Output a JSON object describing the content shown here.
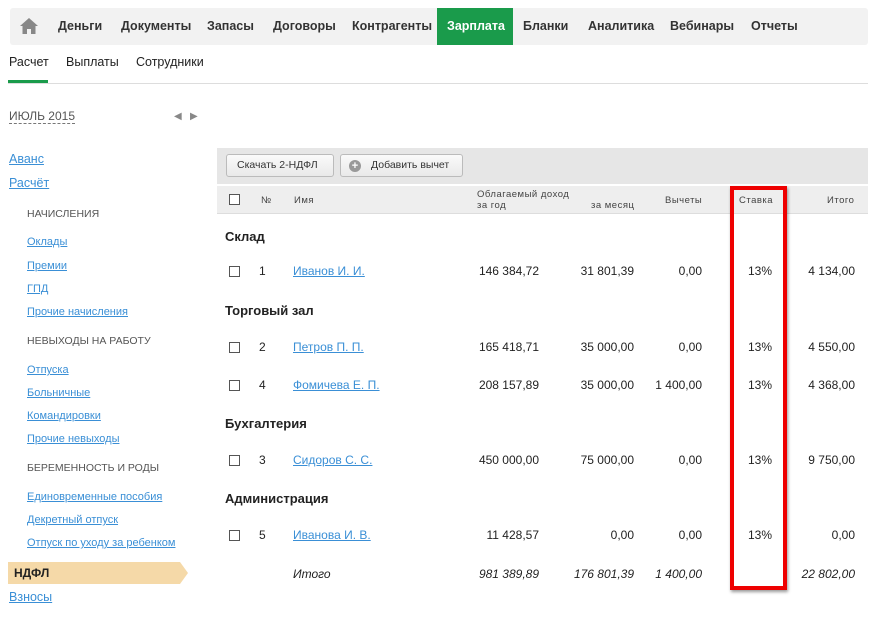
{
  "topnav": {
    "items": [
      "Деньги",
      "Документы",
      "Запасы",
      "Договоры",
      "Контрагенты",
      "Зарплата",
      "Бланки",
      "Аналитика",
      "Вебинары",
      "Отчеты"
    ],
    "active": "Зарплата"
  },
  "subnav": {
    "items": [
      "Расчет",
      "Выплаты",
      "Сотрудники"
    ],
    "active": "Расчет"
  },
  "sidebar": {
    "period": "ИЮЛЬ 2015",
    "links_top": [
      "Аванс",
      "Расчёт"
    ],
    "sections": [
      {
        "title": "НАЧИСЛЕНИЯ",
        "items": [
          "Оклады",
          "Премии",
          "ГПД",
          "Прочие начисления"
        ]
      },
      {
        "title": "НЕВЫХОДЫ НА РАБОТУ",
        "items": [
          "Отпуска",
          "Больничные",
          "Командировки",
          "Прочие невыходы"
        ]
      },
      {
        "title": "БЕРЕМЕННОСТЬ И РОДЫ",
        "items": [
          "Единовременные пособия",
          "Декретный отпуск",
          "Отпуск по уходу за ребенком"
        ]
      }
    ],
    "active": "НДФЛ",
    "bottom": "Взносы"
  },
  "toolbar": {
    "download": "Скачать 2-НДФЛ",
    "add_deduction": "Добавить вычет"
  },
  "table": {
    "headers": {
      "num": "№",
      "name": "Имя",
      "income_year_1": "Облагаемый доход",
      "income_year_2": "за год",
      "income_month": "за месяц",
      "deductions": "Вычеты",
      "rate": "Ставка",
      "total": "Итого"
    },
    "groups": [
      {
        "name": "Склад",
        "rows": [
          {
            "num": "1",
            "name": "Иванов И. И.",
            "year": "146 384,72",
            "month": "31 801,39",
            "ded": "0,00",
            "rate": "13%",
            "total": "4 134,00"
          }
        ]
      },
      {
        "name": "Торговый зал",
        "rows": [
          {
            "num": "2",
            "name": "Петров П. П.",
            "year": "165 418,71",
            "month": "35 000,00",
            "ded": "0,00",
            "rate": "13%",
            "total": "4 550,00"
          },
          {
            "num": "4",
            "name": "Фомичева Е. П.",
            "year": "208 157,89",
            "month": "35 000,00",
            "ded": "1 400,00",
            "rate": "13%",
            "total": "4 368,00"
          }
        ]
      },
      {
        "name": "Бухгалтерия",
        "rows": [
          {
            "num": "3",
            "name": "Сидоров С. С.",
            "year": "450 000,00",
            "month": "75 000,00",
            "ded": "0,00",
            "rate": "13%",
            "total": "9 750,00"
          }
        ]
      },
      {
        "name": "Администрация",
        "rows": [
          {
            "num": "5",
            "name": "Иванова И. В.",
            "year": "11 428,57",
            "month": "0,00",
            "ded": "0,00",
            "rate": "13%",
            "total": "0,00"
          }
        ]
      }
    ],
    "totals": {
      "label": "Итого",
      "year": "981 389,89",
      "month": "176 801,39",
      "ded": "1 400,00",
      "total": "22 802,00"
    }
  }
}
